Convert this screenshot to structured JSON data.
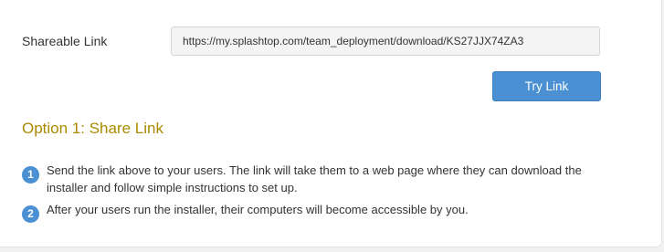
{
  "shareable_link": {
    "label": "Shareable Link",
    "url": "https://my.splashtop.com/team_deployment/download/KS27JJX74ZA3",
    "try_button_label": "Try Link"
  },
  "option": {
    "title": "Option 1: Share Link"
  },
  "steps": [
    {
      "number": "1",
      "text": "Send the link above to your users. The link will take them to a web page where they can download the installer and follow simple instructions to set up."
    },
    {
      "number": "2",
      "text": "After your users run the installer, their computers will become accessible by you."
    }
  ],
  "colors": {
    "accent_blue": "#4a90d2",
    "option_title": "#a98a00"
  }
}
